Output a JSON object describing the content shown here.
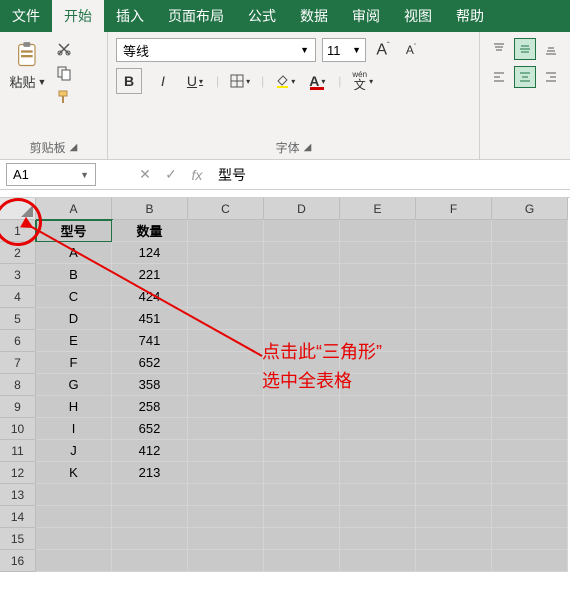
{
  "ribbon": {
    "tabs": [
      "文件",
      "开始",
      "插入",
      "页面布局",
      "公式",
      "数据",
      "审阅",
      "视图",
      "帮助"
    ],
    "activeTab": 1,
    "clipboard": {
      "paste": "粘贴",
      "groupLabel": "剪贴板"
    },
    "font": {
      "family": "等线",
      "size": "11",
      "bold": "B",
      "italic": "I",
      "underline": "U",
      "groupLabel": "字体",
      "wen": "wén",
      "wenChar": "文"
    }
  },
  "formulaBar": {
    "nameBox": "A1",
    "fx": "fx",
    "value": "型号"
  },
  "sheet": {
    "cols": [
      "A",
      "B",
      "C",
      "D",
      "E",
      "F",
      "G"
    ],
    "rows": [
      {
        "n": 1,
        "A": "型号",
        "B": "数量"
      },
      {
        "n": 2,
        "A": "A",
        "B": "124"
      },
      {
        "n": 3,
        "A": "B",
        "B": "221"
      },
      {
        "n": 4,
        "A": "C",
        "B": "424"
      },
      {
        "n": 5,
        "A": "D",
        "B": "451"
      },
      {
        "n": 6,
        "A": "E",
        "B": "741"
      },
      {
        "n": 7,
        "A": "F",
        "B": "652"
      },
      {
        "n": 8,
        "A": "G",
        "B": "358"
      },
      {
        "n": 9,
        "A": "H",
        "B": "258"
      },
      {
        "n": 10,
        "A": "I",
        "B": "652"
      },
      {
        "n": 11,
        "A": "J",
        "B": "412"
      },
      {
        "n": 12,
        "A": "K",
        "B": "213"
      },
      {
        "n": 13,
        "A": "",
        "B": ""
      },
      {
        "n": 14,
        "A": "",
        "B": ""
      },
      {
        "n": 15,
        "A": "",
        "B": ""
      },
      {
        "n": 16,
        "A": "",
        "B": ""
      }
    ]
  },
  "annotation": {
    "line1": "点击此“三角形”",
    "line2": "选中全表格"
  }
}
